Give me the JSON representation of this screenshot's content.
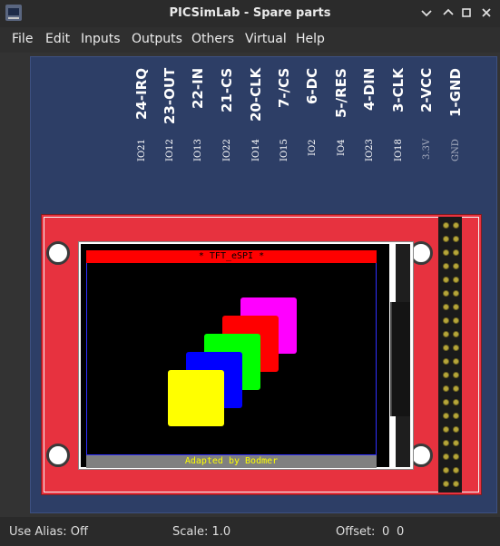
{
  "window": {
    "title": "PICSimLab - Spare parts",
    "minimize_icon": "chevron-down-icon",
    "restore_icon": "chevron-up-icon",
    "maximize_icon": "square-icon",
    "close_icon": "close-icon"
  },
  "menu": [
    "File",
    "Edit",
    "Inputs",
    "Outputs",
    "Others",
    "Virtual",
    "Help"
  ],
  "pins": [
    {
      "name": "24-IRQ",
      "func": "IO21"
    },
    {
      "name": "23-OUT",
      "func": "IO12"
    },
    {
      "name": "22-IN",
      "func": "IO13"
    },
    {
      "name": "21-CS",
      "func": "IO22"
    },
    {
      "name": "20-CLK",
      "func": "IO14"
    },
    {
      "name": "7-/CS",
      "func": "IO15"
    },
    {
      "name": "6-DC",
      "func": "IO2"
    },
    {
      "name": "5-/RES",
      "func": "IO4"
    },
    {
      "name": "4-DIN",
      "func": "IO23"
    },
    {
      "name": "3-CLK",
      "func": "IO18"
    },
    {
      "name": "2-VCC",
      "func": "3.3V"
    },
    {
      "name": "1-GND",
      "func": "GND"
    }
  ],
  "lcd": {
    "header_text": "* TFT_eSPI *",
    "footer_text": "Adapted by Bodmer",
    "colors": {
      "header_bg": "#ff0000",
      "footer_bg": "#808080",
      "footer_fg": "#ffff00",
      "squares": [
        "#ff00ff",
        "#ff0000",
        "#00ff00",
        "#0000ff",
        "#ffff00"
      ]
    }
  },
  "status": {
    "alias": "Use Alias: Off",
    "scale": "Scale: 1.0",
    "offset": "Offset:",
    "offset_x": "0",
    "offset_y": "0"
  }
}
